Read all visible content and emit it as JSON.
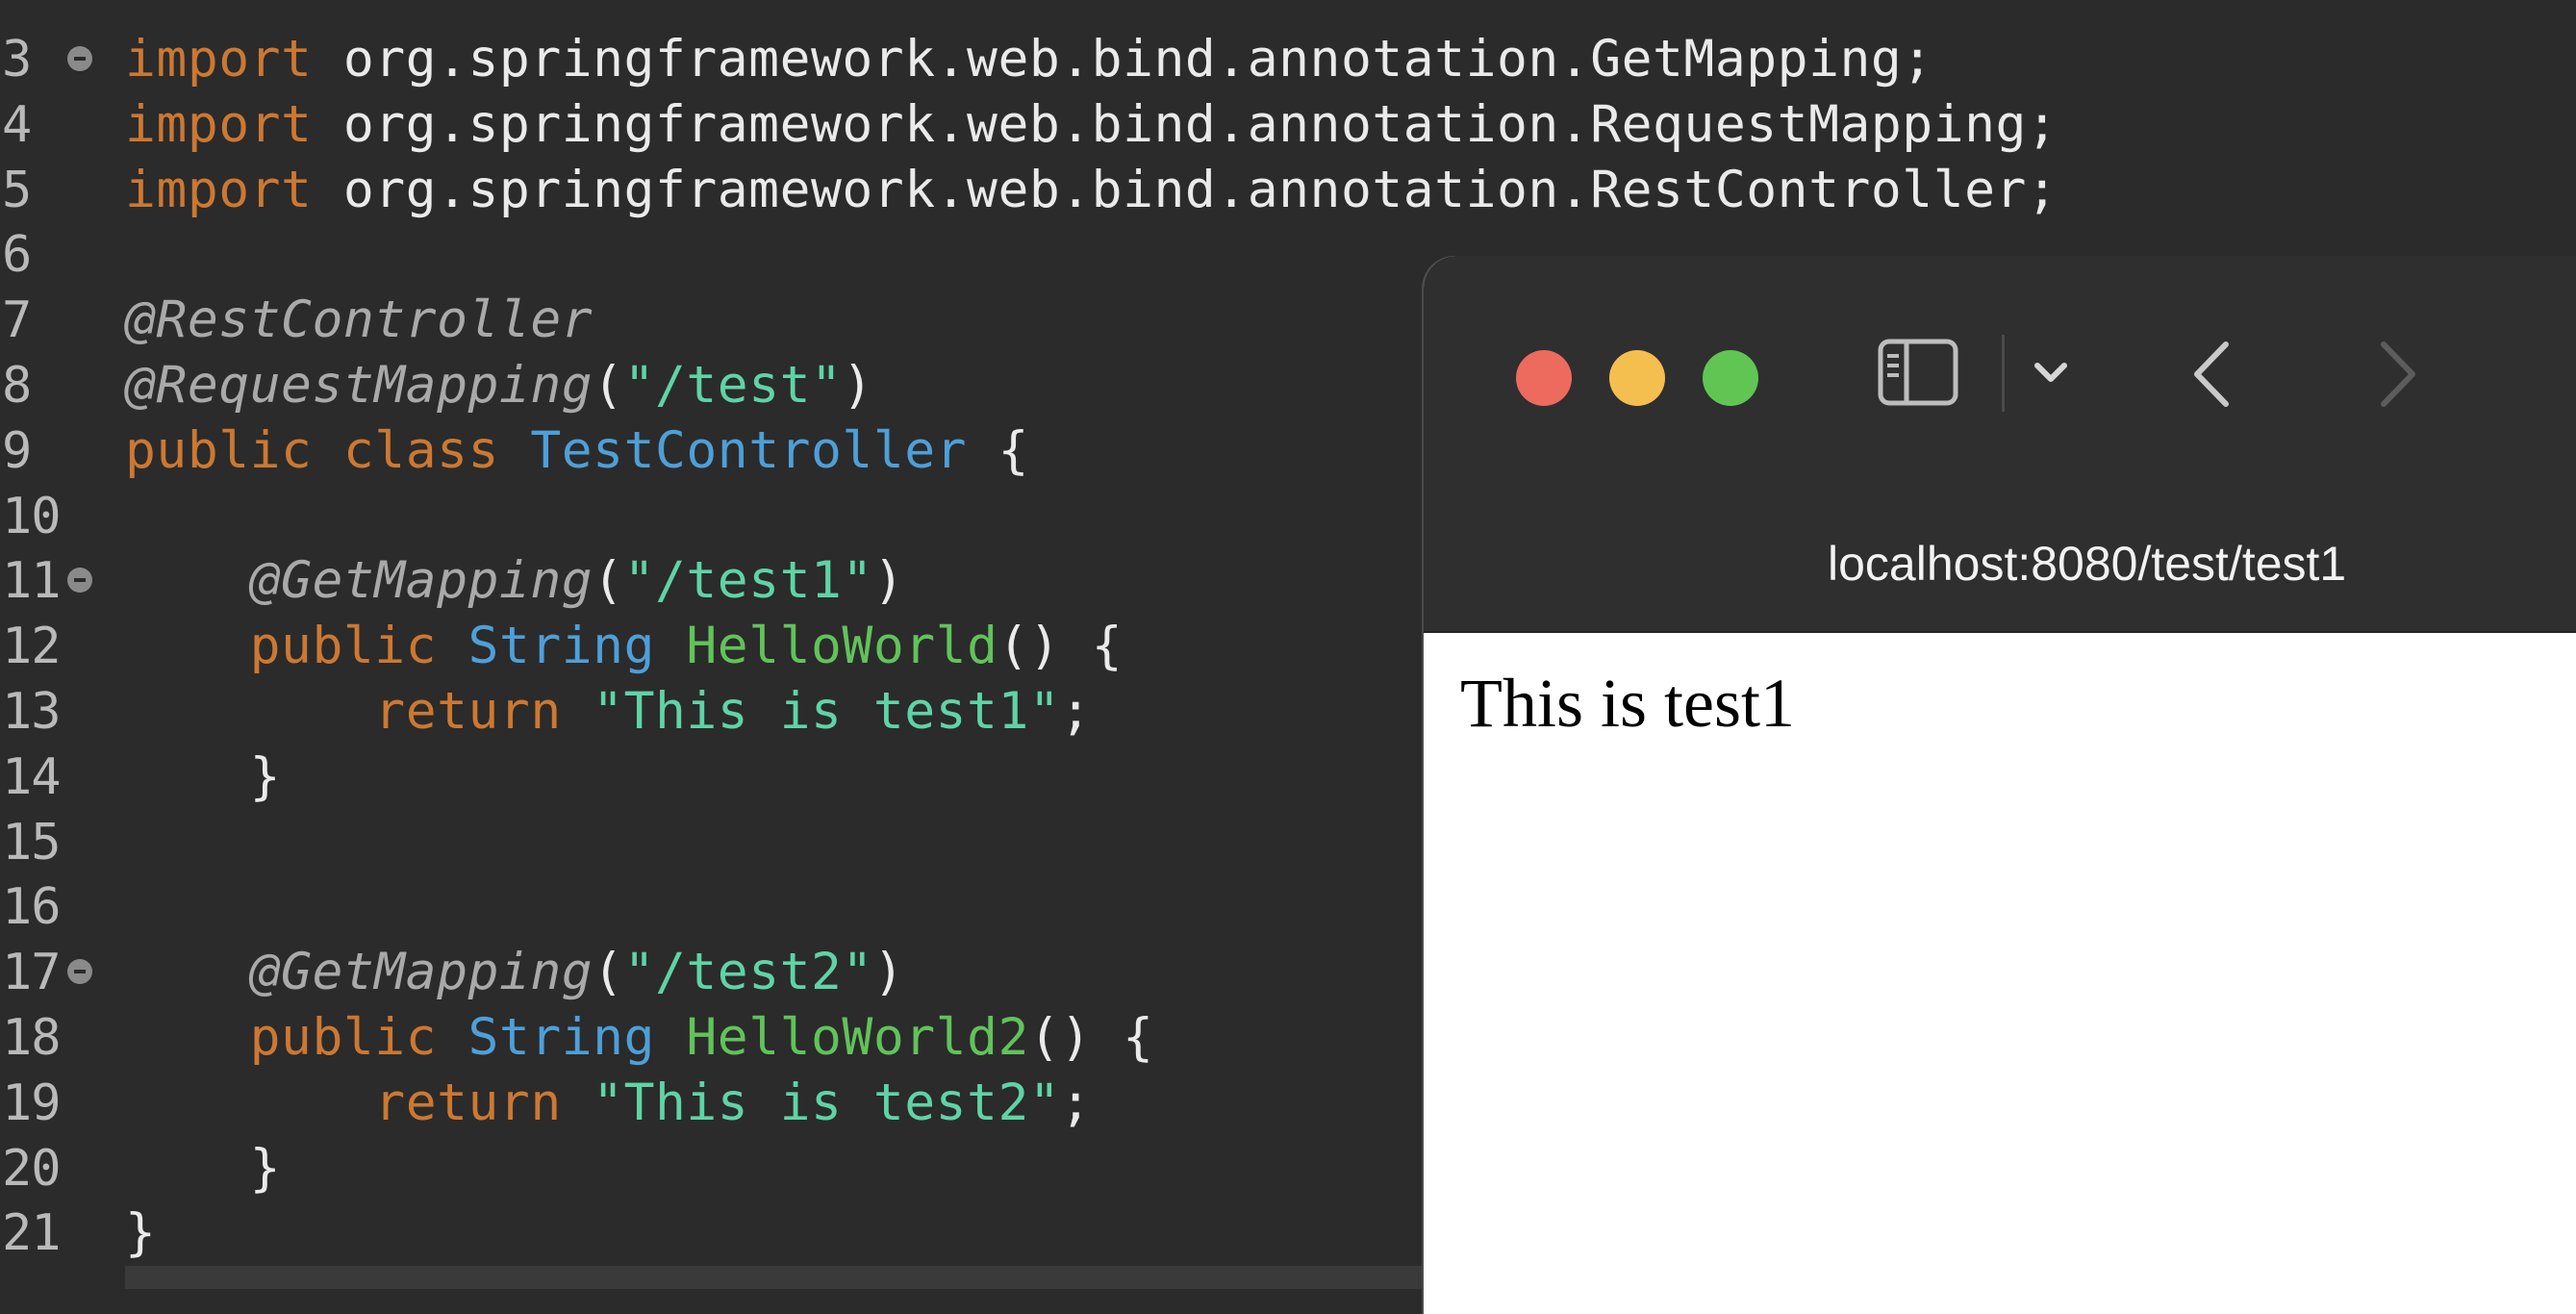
{
  "editor": {
    "lines": [
      {
        "num": "3",
        "fold": true,
        "tokens": [
          [
            "kw",
            "import"
          ],
          [
            "plain",
            " org.springframework.web.bind.annotation.GetMapping;"
          ]
        ]
      },
      {
        "num": "4",
        "fold": false,
        "tokens": [
          [
            "kw",
            "import"
          ],
          [
            "plain",
            " org.springframework.web.bind.annotation.RequestMapping;"
          ]
        ]
      },
      {
        "num": "5",
        "fold": false,
        "tokens": [
          [
            "kw",
            "import"
          ],
          [
            "plain",
            " org.springframework.web.bind.annotation.RestController;"
          ]
        ]
      },
      {
        "num": "6",
        "fold": false,
        "tokens": []
      },
      {
        "num": "7",
        "fold": false,
        "tokens": [
          [
            "ann",
            "@RestController"
          ]
        ]
      },
      {
        "num": "8",
        "fold": false,
        "tokens": [
          [
            "ann",
            "@RequestMapping"
          ],
          [
            "plain",
            "("
          ],
          [
            "str",
            "\"/test\""
          ],
          [
            "plain",
            ")"
          ]
        ]
      },
      {
        "num": "9",
        "fold": false,
        "tokens": [
          [
            "kw",
            "public"
          ],
          [
            "plain",
            " "
          ],
          [
            "kw",
            "class"
          ],
          [
            "plain",
            " "
          ],
          [
            "type",
            "TestController"
          ],
          [
            "plain",
            " {"
          ]
        ]
      },
      {
        "num": "10",
        "fold": false,
        "tokens": []
      },
      {
        "num": "11",
        "fold": true,
        "tokens": [
          [
            "plain",
            "    "
          ],
          [
            "ann",
            "@GetMapping"
          ],
          [
            "plain",
            "("
          ],
          [
            "str",
            "\"/test1\""
          ],
          [
            "plain",
            ")"
          ]
        ]
      },
      {
        "num": "12",
        "fold": false,
        "tokens": [
          [
            "plain",
            "    "
          ],
          [
            "kw",
            "public"
          ],
          [
            "plain",
            " "
          ],
          [
            "type",
            "String"
          ],
          [
            "plain",
            " "
          ],
          [
            "meth",
            "HelloWorld"
          ],
          [
            "plain",
            "() {"
          ]
        ]
      },
      {
        "num": "13",
        "fold": false,
        "tokens": [
          [
            "plain",
            "        "
          ],
          [
            "kw",
            "return"
          ],
          [
            "plain",
            " "
          ],
          [
            "str",
            "\"This is test1\""
          ],
          [
            "plain",
            ";"
          ]
        ]
      },
      {
        "num": "14",
        "fold": false,
        "tokens": [
          [
            "plain",
            "    }"
          ]
        ]
      },
      {
        "num": "15",
        "fold": false,
        "tokens": []
      },
      {
        "num": "16",
        "fold": false,
        "tokens": []
      },
      {
        "num": "17",
        "fold": true,
        "tokens": [
          [
            "plain",
            "    "
          ],
          [
            "ann",
            "@GetMapping"
          ],
          [
            "plain",
            "("
          ],
          [
            "str",
            "\"/test2\""
          ],
          [
            "plain",
            ")"
          ]
        ]
      },
      {
        "num": "18",
        "fold": false,
        "tokens": [
          [
            "plain",
            "    "
          ],
          [
            "kw",
            "public"
          ],
          [
            "plain",
            " "
          ],
          [
            "type",
            "String"
          ],
          [
            "plain",
            " "
          ],
          [
            "meth",
            "HelloWorld2"
          ],
          [
            "plain",
            "() {"
          ]
        ]
      },
      {
        "num": "19",
        "fold": false,
        "tokens": [
          [
            "plain",
            "        "
          ],
          [
            "kw",
            "return"
          ],
          [
            "plain",
            " "
          ],
          [
            "str",
            "\"This is test2\""
          ],
          [
            "plain",
            ";"
          ]
        ]
      },
      {
        "num": "20",
        "fold": false,
        "tokens": [
          [
            "plain",
            "    }"
          ]
        ]
      },
      {
        "num": "21",
        "fold": false,
        "tokens": [
          [
            "plain",
            "}"
          ]
        ]
      }
    ],
    "colors": {
      "background": "#2b2b2b",
      "keyword": "#cc7832",
      "annotation": "#a9a9a9",
      "string": "#5fd3a7",
      "type": "#4e9fd8",
      "method": "#61c35a"
    }
  },
  "browser": {
    "url": "localhost:8080/test/test1",
    "page_text": "This is test1",
    "icons": {
      "close": "close-dot",
      "minimize": "minimize-dot",
      "maximize": "maximize-dot",
      "sidebar": "sidebar-icon",
      "tabs_menu": "chevron-down-icon",
      "back": "chevron-left-icon",
      "forward": "chevron-right-icon"
    },
    "colors": {
      "toolbar": "#2f2f30",
      "close": "#ed6a5e",
      "minimize": "#f4bf4f",
      "maximize": "#61c554"
    }
  }
}
